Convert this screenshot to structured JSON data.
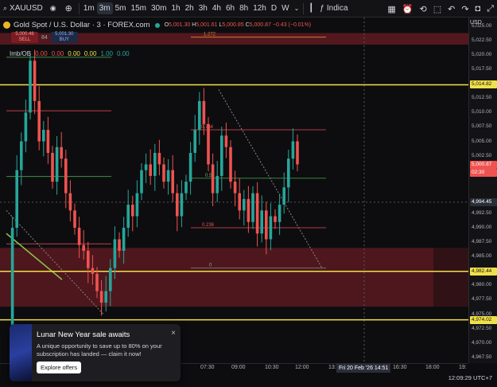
{
  "toolbar": {
    "symbol": "XAUUSD",
    "timeframes": [
      "1m",
      "3m",
      "5m",
      "15m",
      "30m",
      "1h",
      "2h",
      "3h",
      "4h",
      "6h",
      "8h",
      "12h",
      "D",
      "W"
    ],
    "active_timeframe": "3m",
    "indicators_label": "Indica"
  },
  "legend": {
    "title": "Gold Spot / U.S. Dollar · 3 · FOREX.com",
    "open_label": "O",
    "open": "5,001.30",
    "high_label": "H",
    "high": "5,001.61",
    "low_label": "L",
    "low": "5,000.85",
    "close_label": "C",
    "close": "5,000.87",
    "change": "−0.43 (−0.01%)",
    "sell_price": "5,000.46",
    "sell_label": "SELL",
    "spread": "84",
    "buy_price": "5,001.30",
    "buy_label": "BUY",
    "indicator_name": "Imb/OB",
    "indicator_values": [
      "0.00",
      "0.00",
      "0.00",
      "0.00",
      "1.00",
      "0.00"
    ]
  },
  "price_axis": {
    "currency": "USD",
    "labels": [
      "5,025.00",
      "5,022.50",
      "5,020.00",
      "5,017.50",
      "5,012.50",
      "5,010.00",
      "5,007.50",
      "5,005.00",
      "5,002.50",
      "4,992.50",
      "4,990.00",
      "4,987.50",
      "4,985.00",
      "4,980.00",
      "4,977.50",
      "4,975.00",
      "4,972.50",
      "4,970.00",
      "4,967.50"
    ],
    "badge_high": "5,014.82",
    "badge_price": "5,000.87",
    "badge_countdown": "02:30",
    "badge_cursor": "4,994.45",
    "badge_mid": "4,982.44",
    "badge_low": "4,974.02"
  },
  "fib_labels": {
    "l1272": "1.272",
    "l0764": "0.764",
    "l05": "0.5",
    "l0236": "0.236",
    "l0": "0"
  },
  "time_axis": {
    "labels": [
      "07:30",
      "09:00",
      "10:30",
      "12:00",
      "13:",
      "16:30",
      "18:00",
      "19:"
    ],
    "cursor": "Fri 20 Feb '26   14:51"
  },
  "footer": {
    "clock": "12:09:29 UTC+7"
  },
  "toast": {
    "title": "Lunar New Year sale awaits",
    "body": "A unique opportunity to save up to 80% on your subscription has landed — claim it now!",
    "button": "Explore offers",
    "close": "×"
  },
  "colors": {
    "up": "#26a69a",
    "down": "#ef5350",
    "zone": "#5a1a20",
    "yellow": "#f0e04a",
    "fib": "#d88a3a"
  },
  "chart_data": {
    "type": "candlestick",
    "symbol": "XAUUSD",
    "interval": "3m",
    "ylim": [
      4966.5,
      5026.5
    ],
    "levels": {
      "resistance": 5014.82,
      "support_mid": 4982.44,
      "support_low": 4974.02,
      "zone_top": 5023.8,
      "zone_bottom": 5021.8,
      "demand_top": 4986.5,
      "demand_bottom": 4976.3,
      "fib_1272": 5023.1,
      "fib_0764": 5007.0,
      "fib_05": 4998.6,
      "fib_0236": 4990.0,
      "fib_0": 4983.0
    },
    "close_path": [
      4973,
      4990,
      5000,
      5005,
      5010,
      5019,
      5012,
      5005,
      5007,
      5003,
      4998,
      5004,
      5002,
      4996,
      4993,
      4990,
      4987,
      4986,
      4983,
      4982,
      4979,
      4977,
      4979,
      4983,
      4988,
      4986,
      4990,
      4994,
      4992,
      4996,
      5000,
      5001,
      4999,
      5003,
      5001,
      4998,
      5000,
      4996,
      4992,
      4996,
      4998,
      5003,
      5007,
      5012,
      5008,
      5001,
      4996,
      4999,
      5006,
      5004,
      4998,
      4996,
      4993,
      4995,
      4991,
      4996,
      4989,
      4993,
      4988,
      4992,
      4991,
      4994,
      4997,
      5002,
      5005,
      5001
    ]
  }
}
